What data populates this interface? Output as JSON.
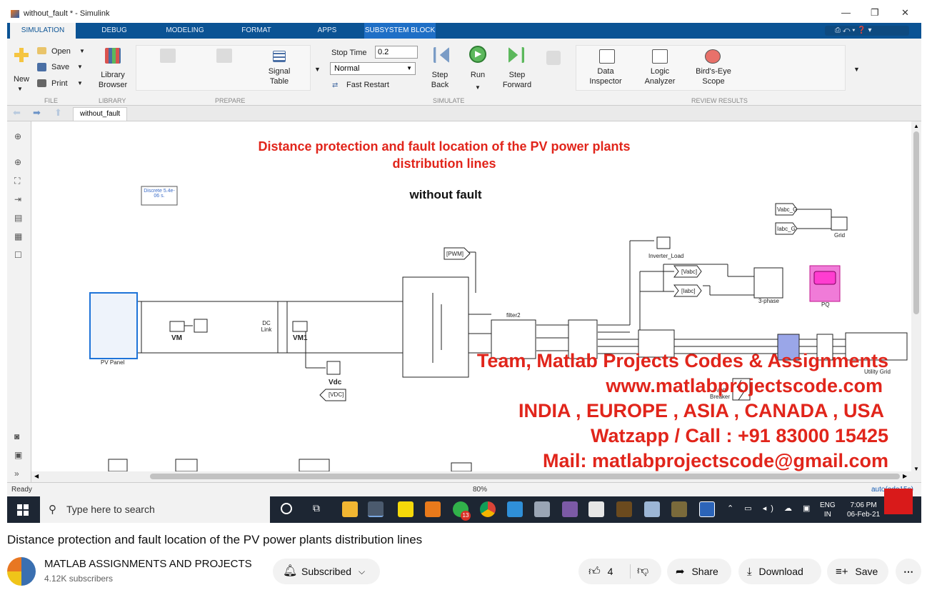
{
  "window": {
    "title": "without_fault * - Simulink"
  },
  "tabs": [
    "SIMULATION",
    "DEBUG",
    "MODELING",
    "FORMAT",
    "APPS",
    "SUBSYSTEM BLOCK"
  ],
  "ribbon": {
    "new": "New",
    "open": "Open",
    "save": "Save",
    "print": "Print",
    "library_browser": "Library Browser",
    "signal_table": "Signal Table",
    "stop_time_label": "Stop Time",
    "stop_time_value": "0.2",
    "mode": "Normal",
    "fast_restart": "Fast Restart",
    "step_back": "Step Back",
    "run": "Run",
    "step_forward": "Step Forward",
    "data_inspector": "Data Inspector",
    "logic_analyzer": "Logic Analyzer",
    "birds_eye": "Bird's-Eye Scope",
    "groups": {
      "file": "FILE",
      "library": "LIBRARY",
      "prepare": "PREPARE",
      "simulate": "SIMULATE",
      "review": "REVIEW RESULTS"
    }
  },
  "breadcrumb": "without_fault",
  "model": {
    "title": "Distance protection and fault location of the PV power plants distribution lines",
    "subtitle": "without fault",
    "powergui": "Discrete 5.4e-06 s.",
    "labels": {
      "pv": "PV Panel",
      "vm": "VM",
      "vm1": "VM1",
      "dc_link": "DC Link",
      "vdc": "Vdc",
      "vdc_tag": "[VDC]",
      "pwm": "[PWM]",
      "filter": "filter2",
      "inverter_load": "Inverter_Load",
      "vabc": "[Vabc]",
      "iabc": "[Iabc]",
      "three_phase": "3-phase",
      "pq": "PQ",
      "vabc_g": "Vabc_G",
      "iabc_g": "Iabc_G",
      "grid": "Grid",
      "fault_breaker": "Fault Breaker",
      "utility": "Utility Grid"
    }
  },
  "watermark": [
    "Team, Matlab Projects Codes & Assignments",
    "www.matlabprojectscode.com",
    "INDIA , EUROPE , ASIA , CANADA , USA",
    "Watzapp / Call : +91 83000 15425",
    "Mail: matlabprojectscode@gmail.com"
  ],
  "status": {
    "left": "Ready",
    "zoom": "80%",
    "right": "auto(ode15s)"
  },
  "taskbar": {
    "search_placeholder": "Type here to search",
    "lang": "ENG",
    "region": "IN",
    "time": "7:06 PM",
    "date": "06-Feb-21",
    "badge": "13"
  },
  "video": {
    "title": "Distance protection and fault location of the PV power plants distribution lines",
    "channel": "MATLAB ASSIGNMENTS AND PROJECTS",
    "subscribers": "4.12K subscribers",
    "subscribed": "Subscribed",
    "likes": "4",
    "share": "Share",
    "download": "Download",
    "save": "Save"
  },
  "colors": {
    "matlab_blue": "#0b5394",
    "watermark_red": "#e1251b",
    "taskbar": "#1d2633"
  }
}
